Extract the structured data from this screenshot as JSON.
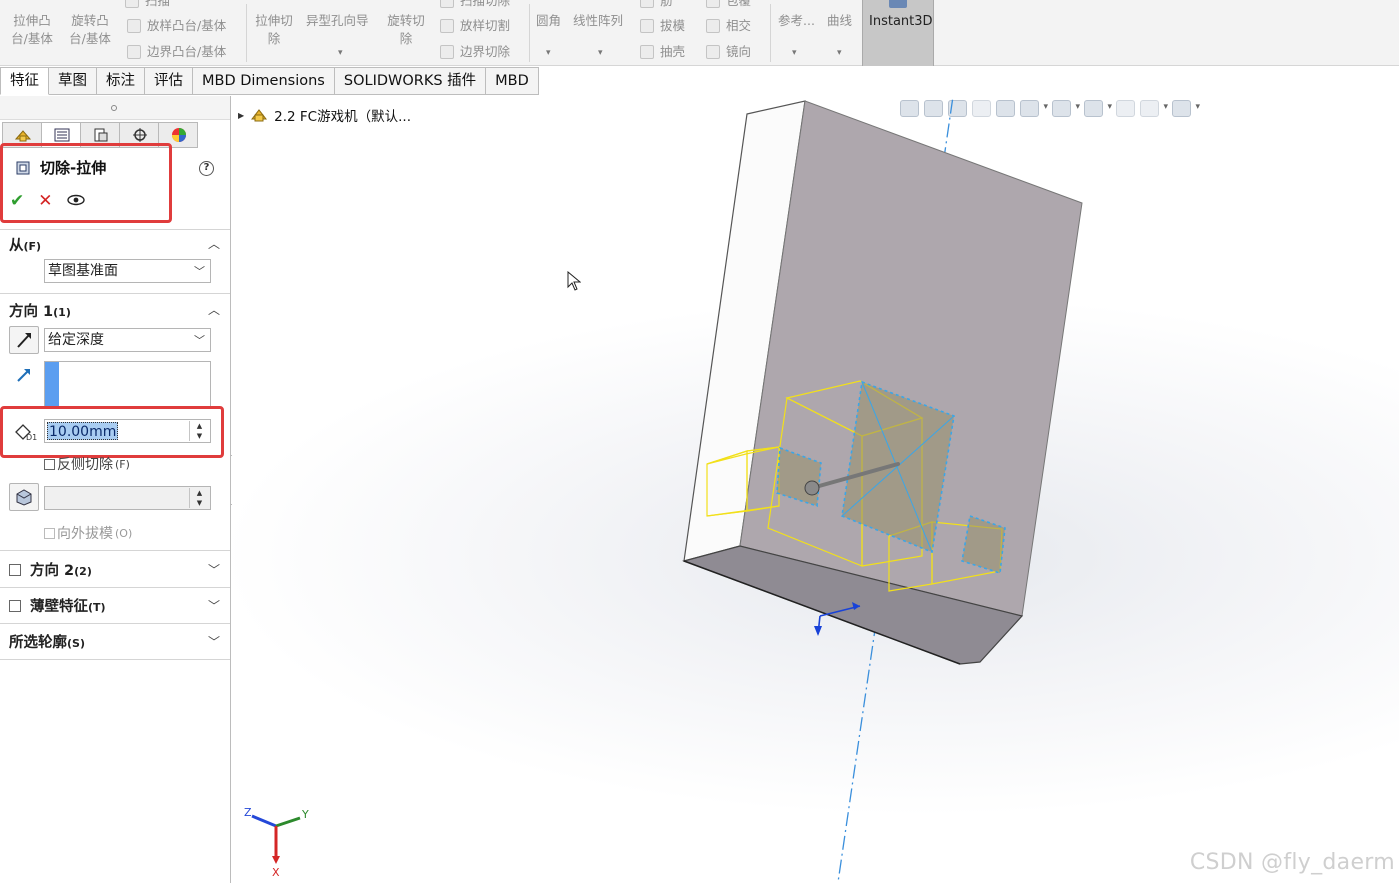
{
  "ribbon": {
    "extrude_boss": "拉伸凸台/基体",
    "revolve_boss": "旋转凸台/基体",
    "sweep": "扫描",
    "loft_boss": "放样凸台/基体",
    "boundary_boss": "边界凸台/基体",
    "extrude_cut": "拉伸切除",
    "hole_wizard": "异型孔向导",
    "revolve_cut": "旋转切除",
    "sweep_cut": "扫描切除",
    "loft_cut": "放样切割",
    "boundary_cut": "边界切除",
    "fillet": "圆角",
    "linear_pattern": "线性阵列",
    "rib": "筋",
    "draft": "拔模",
    "shell": "抽壳",
    "wrap": "包覆",
    "intersect": "相交",
    "mirror": "镜向",
    "reference": "参考...",
    "curves": "曲线",
    "instant3d": "Instant3D"
  },
  "tabs": [
    "特征",
    "草图",
    "标注",
    "评估",
    "MBD Dimensions",
    "SOLIDWORKS 插件",
    "MBD"
  ],
  "feature": {
    "title": "切除-拉伸",
    "help": "?"
  },
  "from": {
    "label": "从",
    "key": "(F)",
    "value": "草图基准面"
  },
  "direction1": {
    "label": "方向 1",
    "key": "(1)",
    "end_condition": "给定深度",
    "depth": "10.00mm",
    "flip_side": "反侧切除",
    "flip_key": "(F)",
    "draft_outward": "向外拔模",
    "draft_key": "(O)"
  },
  "direction2": {
    "label": "方向 2",
    "key": "(2)"
  },
  "thin_feature": {
    "label": "薄壁特征",
    "key": "(T)"
  },
  "selected_contours": {
    "label": "所选轮廓",
    "key": "(S)"
  },
  "tree": {
    "part": "2.2 FC游戏机（默认..."
  },
  "triad": {
    "x": "X",
    "y": "Y",
    "z": "Z"
  },
  "watermark": "CSDN @fly_daerm",
  "colors": {
    "highlight_box": "#e03c3c",
    "part_face": "#aea7ad",
    "sketch_yellow": "#f2e01a",
    "selection_cyan": "#3aa6e8"
  }
}
